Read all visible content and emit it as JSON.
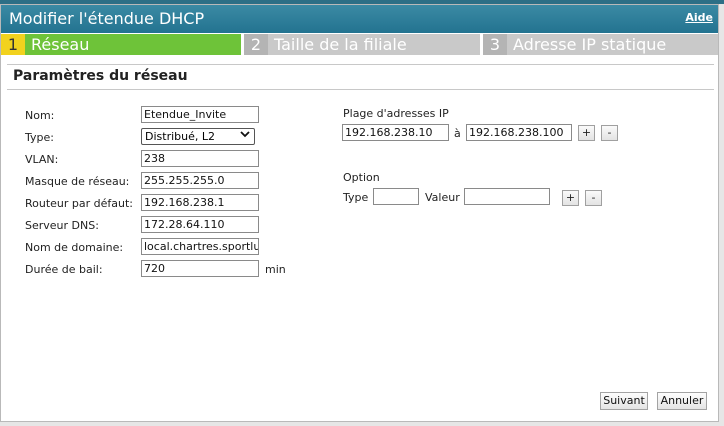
{
  "dialog": {
    "title": "Modifier l'étendue DHCP",
    "help_label": "Aide"
  },
  "steps": [
    {
      "num": "1",
      "label": "Réseau"
    },
    {
      "num": "2",
      "label": "Taille de la filiale"
    },
    {
      "num": "3",
      "label": "Adresse IP statique"
    }
  ],
  "section": {
    "title": "Paramètres du réseau"
  },
  "form": {
    "name_label": "Nom:",
    "name_value": "Etendue_Invite",
    "type_label": "Type:",
    "type_value": "Distribué, L2",
    "vlan_label": "VLAN:",
    "vlan_value": "238",
    "netmask_label": "Masque de réseau:",
    "netmask_value": "255.255.255.0",
    "gateway_label": "Routeur par défaut:",
    "gateway_value": "192.168.238.1",
    "dns_label": "Serveur DNS:",
    "dns_value": "172.28.64.110",
    "domain_label": "Nom de domaine:",
    "domain_value": "local.chartres.sportlu",
    "lease_label": "Durée de bail:",
    "lease_value": "720",
    "lease_unit": "min"
  },
  "ip_range": {
    "label": "Plage d'adresses IP",
    "start": "192.168.238.10",
    "separator": "à",
    "end": "192.168.238.100",
    "add_label": "+",
    "remove_label": "-"
  },
  "option": {
    "label": "Option",
    "type_label": "Type",
    "type_value": "",
    "value_label": "Valeur",
    "value_value": "",
    "add_label": "+",
    "remove_label": "-"
  },
  "footer": {
    "next_label": "Suivant",
    "cancel_label": "Annuler"
  },
  "colors": {
    "title_bar": "#2d7e9a",
    "active_step": "#6ec339",
    "active_step_number": "#f2d21e",
    "inactive_step": "#c9c9c9"
  },
  "icons": {
    "type_dropdown": "chevron-down-icon"
  }
}
